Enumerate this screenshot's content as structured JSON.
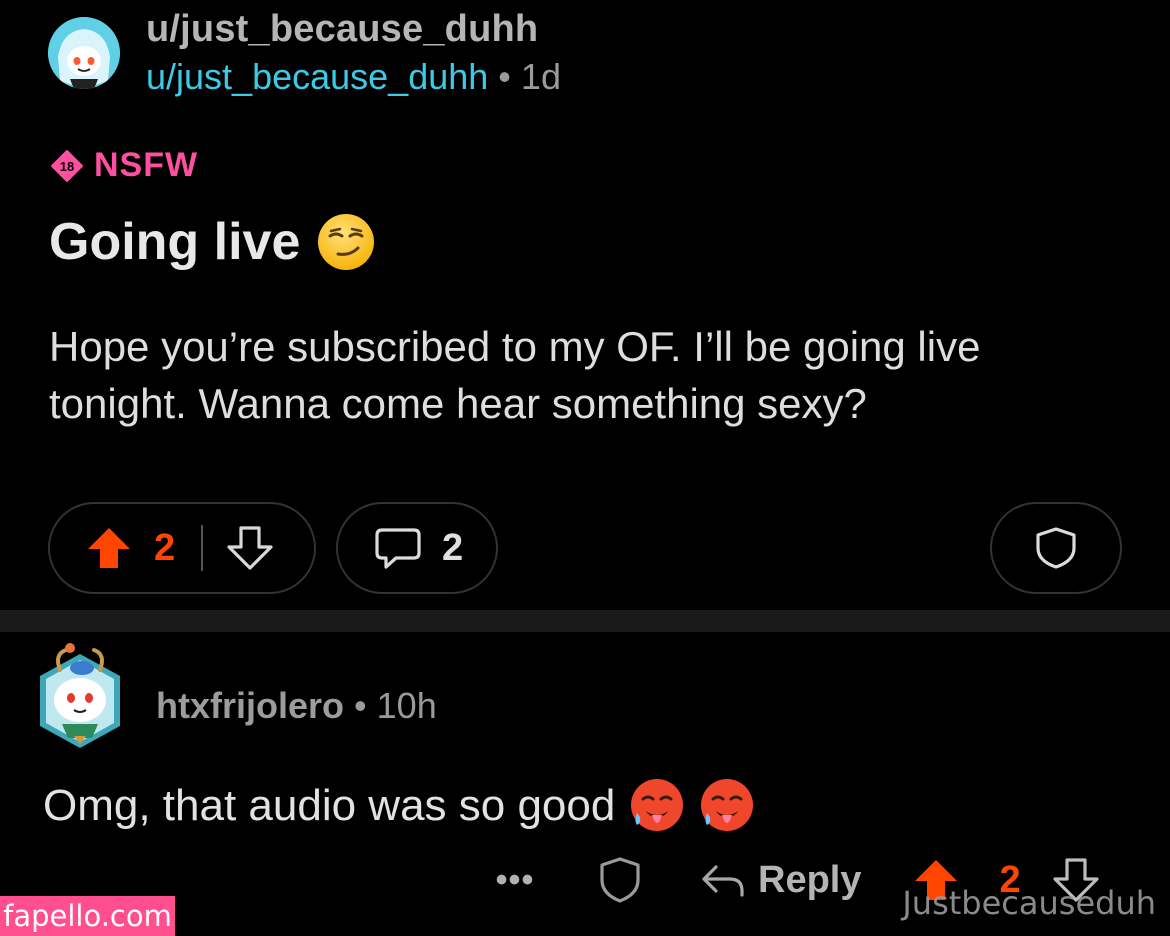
{
  "post": {
    "username_top": "u/just_because_duhh",
    "author": "u/just_because_duhh",
    "separator": "•",
    "age": "1d",
    "nsfw_badge_number": "18",
    "nsfw_label": "NSFW",
    "title": "Going live",
    "title_emoji": "smirking-face",
    "body": "Hope you’re subscribed to my OF. I’ll be going live tonight. Wanna come hear something sexy?",
    "upvotes": "2",
    "comments": "2"
  },
  "comment": {
    "author": "htxfrijolero",
    "separator": "•",
    "age": "10h",
    "text": "Omg, that audio was so good",
    "emojis": [
      "hot-face",
      "hot-face"
    ],
    "more_label": "•••",
    "reply_label": "Reply",
    "upvotes": "2"
  },
  "watermarks": {
    "left": "fapello.com",
    "right": "Justbecauseduh"
  },
  "colors": {
    "upvote_active": "#ff4500",
    "author_link": "#3ec9e6",
    "nsfw": "#ff4fa0",
    "pill_border": "#333333"
  },
  "icons": [
    "upvote-icon",
    "downvote-icon",
    "comment-icon",
    "shield-icon",
    "reply-arrow-icon"
  ]
}
